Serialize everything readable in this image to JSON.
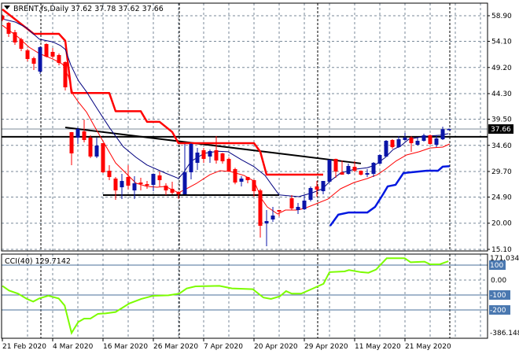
{
  "header": {
    "symbol": "BRENT,fs,Daily",
    "ohlc": "37.62 37.78 37.62 37.66",
    "menu_icon": "triangle-down-icon"
  },
  "price_axis": {
    "labels": [
      "58.90",
      "54.10",
      "49.20",
      "44.30",
      "39.50",
      "34.60",
      "29.70",
      "24.90",
      "20.00",
      "15.10"
    ],
    "current_price": "37.66"
  },
  "cci": {
    "label": "CCI(40) 129.7142",
    "max_label": "171.0341",
    "min_label": "-386.148",
    "zero_label": "0.00",
    "levels": [
      "100",
      "-100",
      "-200"
    ]
  },
  "time_axis": {
    "labels": [
      "21 Feb 2020",
      "4 Mar 2020",
      "16 Mar 2020",
      "26 Mar 2020",
      "7 Apr 2020",
      "20 Apr 2020",
      "29 Apr 2020",
      "11 May 2020",
      "21 May 2020"
    ]
  },
  "colors": {
    "bull": "#0a14a8",
    "bear": "#ff0000",
    "cci_line": "#7cfc00",
    "grid": "#7a8a9a",
    "level_box": "#4a78b0"
  },
  "chart_data": {
    "type": "candlestick",
    "title": "BRENT,fs,Daily",
    "ylim": [
      15.1,
      58.9
    ],
    "candles_ohlc": [
      [
        58.9,
        59.1,
        57.9,
        58.16
      ],
      [
        57.57,
        57.72,
        54.92,
        55.51
      ],
      [
        55.8,
        56.25,
        53.44,
        53.89
      ],
      [
        54.48,
        54.77,
        52.26,
        52.7
      ],
      [
        52.41,
        52.7,
        50.35,
        50.79
      ],
      [
        50.94,
        51.23,
        48.72,
        49.9
      ],
      [
        48.43,
        53.15,
        47.99,
        53.0
      ],
      [
        53.59,
        53.74,
        51.08,
        51.23
      ],
      [
        52.12,
        52.85,
        50.94,
        51.23
      ],
      [
        51.53,
        51.82,
        49.61,
        50.05
      ],
      [
        50.2,
        50.35,
        44.89,
        45.48
      ],
      [
        37.07,
        37.1,
        30.88,
        33.09
      ],
      [
        36.04,
        37.96,
        34.86,
        37.66
      ],
      [
        37.22,
        39.43,
        35.15,
        35.6
      ],
      [
        36.04,
        36.48,
        32.2,
        32.5
      ],
      [
        32.5,
        36.04,
        32.2,
        34.56
      ],
      [
        35.01,
        35.01,
        29.4,
        29.55
      ],
      [
        29.84,
        30.88,
        28.07,
        28.66
      ],
      [
        28.37,
        28.66,
        24.38,
        26.15
      ],
      [
        26.74,
        29.25,
        24.53,
        27.92
      ],
      [
        28.66,
        30.88,
        26.3,
        27.04
      ],
      [
        26.15,
        28.81,
        24.53,
        27.48
      ],
      [
        27.63,
        28.51,
        26.15,
        27.33
      ],
      [
        27.33,
        27.92,
        26.45,
        27.04
      ],
      [
        27.19,
        29.25,
        26.01,
        29.25
      ],
      [
        28.96,
        29.69,
        26.89,
        28.07
      ],
      [
        27.04,
        27.48,
        25.27,
        26.15
      ],
      [
        26.45,
        27.78,
        25.42,
        25.71
      ],
      [
        25.86,
        26.01,
        24.53,
        25.42
      ],
      [
        25.42,
        34.86,
        25.42,
        29.55
      ],
      [
        29.55,
        35.01,
        28.22,
        34.86
      ],
      [
        31.32,
        34.12,
        29.99,
        33.24
      ],
      [
        33.68,
        34.12,
        31.32,
        32.06
      ],
      [
        32.5,
        33.83,
        31.32,
        33.53
      ],
      [
        33.68,
        36.33,
        31.17,
        31.76
      ],
      [
        33.09,
        33.2,
        31.17,
        31.61
      ],
      [
        32.06,
        32.35,
        29.69,
        29.69
      ],
      [
        30.14,
        30.4,
        27.3,
        27.63
      ],
      [
        27.78,
        28.81,
        26.89,
        28.37
      ],
      [
        28.66,
        28.7,
        27.48,
        28.07
      ],
      [
        28.07,
        28.2,
        24.97,
        26.01
      ],
      [
        26.15,
        26.45,
        17.31,
        19.52
      ],
      [
        19.96,
        22.47,
        15.68,
        20.4
      ],
      [
        20.7,
        23.06,
        20.26,
        21.44
      ],
      [
        22.47,
        22.5,
        21.3,
        22.18
      ],
      null,
      [
        24.68,
        25.27,
        22.47,
        22.77
      ],
      [
        22.47,
        23.79,
        21.73,
        23.06
      ],
      [
        22.62,
        25.27,
        22.47,
        24.24
      ],
      [
        24.38,
        26.89,
        24.09,
        26.6
      ],
      [
        26.89,
        27.92,
        24.97,
        26.3
      ],
      [
        26.01,
        27.92,
        25.42,
        27.92
      ],
      [
        27.78,
        31.91,
        27.6,
        31.91
      ],
      [
        32.06,
        32.1,
        28.51,
        29.69
      ],
      [
        29.55,
        31.76,
        29.1,
        29.1
      ],
      [
        29.25,
        31.17,
        29.1,
        30.73
      ],
      [
        30.58,
        31.61,
        29.55,
        29.84
      ],
      [
        29.84,
        29.9,
        28.96,
        29.1
      ],
      [
        29.1,
        30.14,
        28.66,
        29.4
      ],
      [
        29.25,
        31.47,
        28.66,
        31.32
      ],
      [
        31.17,
        32.94,
        31.0,
        32.79
      ],
      [
        32.5,
        35.6,
        32.4,
        35.45
      ],
      [
        35.6,
        35.74,
        33.98,
        34.27
      ],
      [
        34.27,
        36.33,
        34.12,
        35.74
      ],
      [
        35.6,
        36.92,
        35.5,
        36.04
      ],
      [
        36.04,
        36.33,
        33.38,
        35.01
      ],
      [
        34.71,
        36.04,
        34.56,
        35.45
      ],
      [
        35.45,
        36.77,
        35.3,
        36.48
      ],
      [
        36.48,
        36.63,
        34.71,
        34.86
      ],
      [
        34.71,
        36.48,
        34.27,
        35.89
      ],
      [
        35.74,
        38.1,
        35.6,
        37.62
      ],
      [
        37.62,
        37.78,
        37.62,
        37.66
      ]
    ],
    "label_every_bars": 8,
    "month_start_bars": [
      6,
      28,
      50,
      71
    ],
    "indicators": {
      "trailing_stop_red": [
        [
          0,
          60.1
        ],
        [
          5,
          55.5
        ],
        [
          9,
          55.5
        ],
        [
          10,
          54.2
        ],
        [
          11,
          44.4
        ],
        [
          17,
          44.4
        ],
        [
          18,
          41.0
        ],
        [
          22,
          41.0
        ],
        [
          23,
          39.0
        ],
        [
          25,
          39.0
        ],
        [
          27,
          37.1
        ],
        [
          28,
          35.0
        ],
        [
          40,
          35.0
        ],
        [
          41,
          33.4
        ],
        [
          42,
          29.1
        ],
        [
          51,
          29.1
        ]
      ],
      "ma_navy": [
        [
          0,
          58.3
        ],
        [
          2.1,
          57.7
        ],
        [
          3.75,
          56.7
        ],
        [
          5.9,
          54.5
        ],
        [
          8,
          54.0
        ],
        [
          9.25,
          53.3
        ],
        [
          10,
          52.6
        ],
        [
          10.9,
          49.6
        ],
        [
          12.1,
          46.7
        ],
        [
          13.4,
          44.6
        ],
        [
          15,
          41.6
        ],
        [
          17.1,
          37.8
        ],
        [
          19.25,
          34.3
        ],
        [
          21.25,
          32.35
        ],
        [
          23,
          30.9
        ],
        [
          25.9,
          29.4
        ],
        [
          28,
          28.4
        ],
        [
          28.75,
          29.4
        ],
        [
          30,
          31.6
        ],
        [
          32.1,
          33.1
        ],
        [
          34.25,
          33.5
        ],
        [
          35.9,
          33.4
        ],
        [
          38,
          31.9
        ],
        [
          40,
          30.6
        ],
        [
          41.75,
          28.96
        ],
        [
          43,
          26.9
        ],
        [
          44,
          25.3
        ],
        [
          47.1,
          24.97
        ],
        [
          49.25,
          25.7
        ],
        [
          50.9,
          26.45
        ],
        [
          52.1,
          27.9
        ],
        [
          53.75,
          29.4
        ],
        [
          55.9,
          30.1
        ],
        [
          58,
          30.4
        ],
        [
          59.25,
          30.9
        ],
        [
          60.9,
          32.35
        ],
        [
          62.1,
          33.8
        ],
        [
          63.4,
          34.56
        ],
        [
          64.6,
          35.74
        ],
        [
          67.1,
          36.3
        ],
        [
          69.6,
          36.5
        ],
        [
          70.9,
          36.8
        ]
      ],
      "ma_red": [
        [
          0,
          57.1
        ],
        [
          2.5,
          54.9
        ],
        [
          4.25,
          53.0
        ],
        [
          5.9,
          51.8
        ],
        [
          8,
          50.8
        ],
        [
          9.6,
          49.8
        ],
        [
          10.5,
          47.5
        ],
        [
          11.25,
          44.15
        ],
        [
          12.1,
          42.7
        ],
        [
          13.4,
          40.8
        ],
        [
          14.6,
          38.25
        ],
        [
          16.25,
          34.86
        ],
        [
          18,
          31.3
        ],
        [
          20,
          28.96
        ],
        [
          21.25,
          27.5
        ],
        [
          23,
          26.9
        ],
        [
          24.6,
          26.75
        ],
        [
          25.9,
          26.9
        ],
        [
          28,
          25.7
        ],
        [
          29.25,
          26.45
        ],
        [
          30.9,
          27.5
        ],
        [
          33,
          29.1
        ],
        [
          34.6,
          29.85
        ],
        [
          36.25,
          29.7
        ],
        [
          38.4,
          28.96
        ],
        [
          40,
          27.9
        ],
        [
          41.25,
          24.5
        ],
        [
          42.1,
          23.06
        ],
        [
          43.75,
          21.73
        ],
        [
          45,
          22.47
        ],
        [
          46.75,
          22.47
        ],
        [
          48,
          22.77
        ],
        [
          49.6,
          23.5
        ],
        [
          51.75,
          24.53
        ],
        [
          53.75,
          26.45
        ],
        [
          55.9,
          27.63
        ],
        [
          58,
          28.37
        ],
        [
          59.6,
          29.1
        ],
        [
          60.9,
          30.14
        ],
        [
          62.5,
          31.6
        ],
        [
          64.25,
          32.8
        ],
        [
          66.25,
          33.4
        ],
        [
          68,
          34.1
        ],
        [
          70,
          34.27
        ],
        [
          71.1,
          34.86
        ]
      ],
      "lower_band_blue": [
        [
          52.1,
          19.5
        ],
        [
          53.4,
          21.6
        ],
        [
          55,
          22.0
        ],
        [
          58,
          22.0
        ],
        [
          59.25,
          23.06
        ],
        [
          60.5,
          25.4
        ],
        [
          61.25,
          26.9
        ],
        [
          62.5,
          27.2
        ],
        [
          63.75,
          29.4
        ],
        [
          66.25,
          29.7
        ],
        [
          67.5,
          29.84
        ],
        [
          69.25,
          29.84
        ],
        [
          70,
          30.6
        ],
        [
          71.1,
          30.7
        ]
      ]
    },
    "drawn_lines": {
      "resistance_horizontal": 36.2,
      "descending_trendline": [
        [
          10,
          37.96
        ],
        [
          57,
          31.2
        ]
      ],
      "support_horizontal": [
        [
          16,
          25.27
        ],
        [
          44,
          25.27
        ]
      ]
    },
    "cci_series": [
      [
        0,
        -39
      ],
      [
        1.06,
        -70
      ],
      [
        2.5,
        -91
      ],
      [
        3.9,
        -126
      ],
      [
        4.9,
        -144
      ],
      [
        5.85,
        -123
      ],
      [
        7.3,
        -105
      ],
      [
        8.95,
        -123
      ],
      [
        9.9,
        -170
      ],
      [
        11,
        -354
      ],
      [
        12.06,
        -281
      ],
      [
        13,
        -258
      ],
      [
        14,
        -258
      ],
      [
        15.2,
        -226
      ],
      [
        16.4,
        -223
      ],
      [
        18,
        -214
      ],
      [
        20.2,
        -156
      ],
      [
        22.1,
        -126
      ],
      [
        24,
        -105
      ],
      [
        26.4,
        -102
      ],
      [
        28.1,
        -91
      ],
      [
        29.3,
        -56
      ],
      [
        30.7,
        -42
      ],
      [
        34.5,
        -39
      ],
      [
        36.5,
        -56
      ],
      [
        39.8,
        -61
      ],
      [
        41.5,
        -117
      ],
      [
        42.7,
        -126
      ],
      [
        44.1,
        -109
      ],
      [
        45.1,
        -74
      ],
      [
        46,
        -91
      ],
      [
        47.5,
        -91
      ],
      [
        49.4,
        -56
      ],
      [
        51.05,
        -25
      ],
      [
        52,
        53
      ],
      [
        54.4,
        58
      ],
      [
        55.1,
        67
      ],
      [
        57,
        53
      ],
      [
        58.2,
        49
      ],
      [
        59.4,
        70
      ],
      [
        61.1,
        146
      ],
      [
        63.96,
        146
      ],
      [
        64.9,
        119
      ],
      [
        67.1,
        123
      ],
      [
        68,
        105
      ],
      [
        69.5,
        105
      ],
      [
        70.9,
        126
      ]
    ],
    "cci_ylim": [
      -386.148,
      171.0341
    ]
  }
}
